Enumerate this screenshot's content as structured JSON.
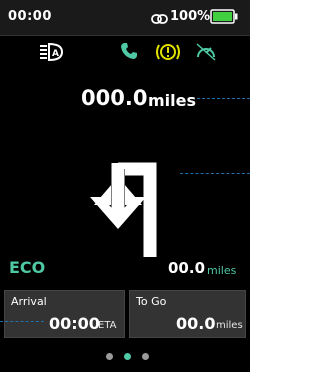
{
  "status": {
    "time": "00:00",
    "battery_percent": "100%"
  },
  "indicators": {
    "headlight": "headlight-icon",
    "phone": "phone-icon",
    "warning": "warning-icon",
    "speedometer": "speedometer-icon"
  },
  "trip": {
    "value": "000.0",
    "unit": "miles"
  },
  "navigation": {
    "direction_icon": "turn-left-arrow-icon"
  },
  "mode": {
    "label": "ECO"
  },
  "next_turn": {
    "value": "00.0",
    "unit": "miles"
  },
  "arrival": {
    "label": "Arrival",
    "value": "00:00",
    "unit": "ETA"
  },
  "to_go": {
    "label": "To Go",
    "value": "00.0",
    "unit": "miles"
  },
  "pager": {
    "count": 3,
    "active": 1
  },
  "colors": {
    "accent": "#4fc9a4",
    "warning": "#e0e000",
    "battery": "#3fcf3f",
    "background": "#000000"
  }
}
